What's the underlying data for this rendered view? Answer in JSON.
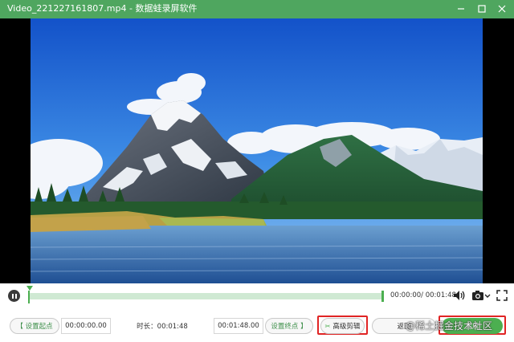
{
  "window": {
    "title": "Video_221227161807.mp4 - 数据蛙录屏软件",
    "accent_color": "#4fa65f"
  },
  "player": {
    "progress": 0.0,
    "time_readout": "00:00:00/ 00:01:48"
  },
  "icons": {
    "minimize": "minimize-icon",
    "maximize": "maximize-icon",
    "close": "close-icon",
    "pause": "pause-icon",
    "volume": "volume-icon",
    "camera": "camera-icon",
    "fullscreen": "fullscreen-icon",
    "scissors": "scissors-icon"
  },
  "trim": {
    "set_start_label": "【 设置起点",
    "start_time": "00:00:00.00",
    "duration_label": "时长：00:01:48",
    "end_time": "00:01:48.00",
    "set_end_label": "设置终点 】",
    "advanced_cut_label": "高级剪辑",
    "back_label": "返回",
    "finish_label": "完成"
  },
  "watermark": "@稀土掘金技术社区"
}
